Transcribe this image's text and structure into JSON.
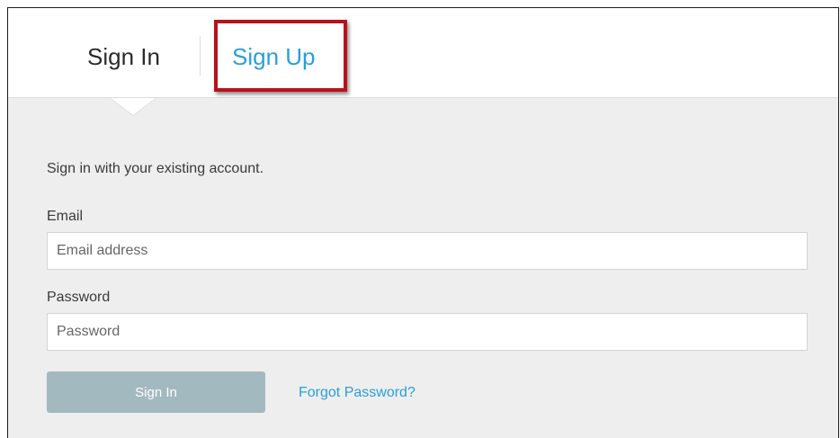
{
  "tabs": {
    "sign_in_label": "Sign In",
    "sign_up_label": "Sign Up"
  },
  "form": {
    "intro_text": "Sign in with your existing account.",
    "email_label": "Email",
    "email_placeholder": "Email address",
    "email_value": "",
    "password_label": "Password",
    "password_placeholder": "Password",
    "password_value": "",
    "submit_label": "Sign In",
    "forgot_link_label": "Forgot Password?"
  },
  "colors": {
    "accent": "#2a9fd8",
    "highlight": "#b8121b",
    "button_bg": "#a3b9c0",
    "panel_bg": "#eeeeee"
  }
}
